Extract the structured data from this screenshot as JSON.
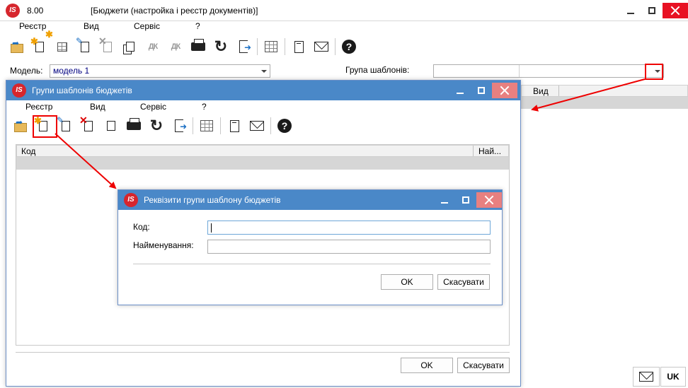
{
  "main_window": {
    "version": "8.00",
    "title": "[Бюджети (настройка і реєстр документів)]",
    "menu": [
      "Реєстр",
      "Вид",
      "Сервіс",
      "?"
    ],
    "model_label": "Модель:",
    "model_value": "модель 1",
    "template_group_label": "Група шаблонів:",
    "template_group_value": "",
    "grid_header_view": "Вид",
    "status_language": "UK"
  },
  "groups_window": {
    "title": "Групи шаблонів бюджетів",
    "menu": [
      "Реєстр",
      "Вид",
      "Сервіс",
      "?"
    ],
    "columns": [
      "Код",
      "Най..."
    ],
    "ok_label": "OK",
    "cancel_label": "Скасувати"
  },
  "details_window": {
    "title": "Реквізити групи шаблону бюджетів",
    "code_label": "Код:",
    "code_value": "",
    "name_label": "Найменування:",
    "name_value": "",
    "ok_label": "OK",
    "cancel_label": "Скасувати"
  },
  "colors": {
    "titlebar": "#4a88c8",
    "highlight": "#e00000",
    "close": "#e81123"
  },
  "icons": [
    "app-logo-icon",
    "open-folder-icon",
    "new-doc-icon",
    "new-child-icon",
    "edit-icon",
    "delete-icon",
    "copy-icon",
    "debit-credit-icon",
    "print-icon",
    "refresh-icon",
    "exit-icon",
    "grid-icon",
    "notebook-icon",
    "mail-icon",
    "help-icon"
  ]
}
